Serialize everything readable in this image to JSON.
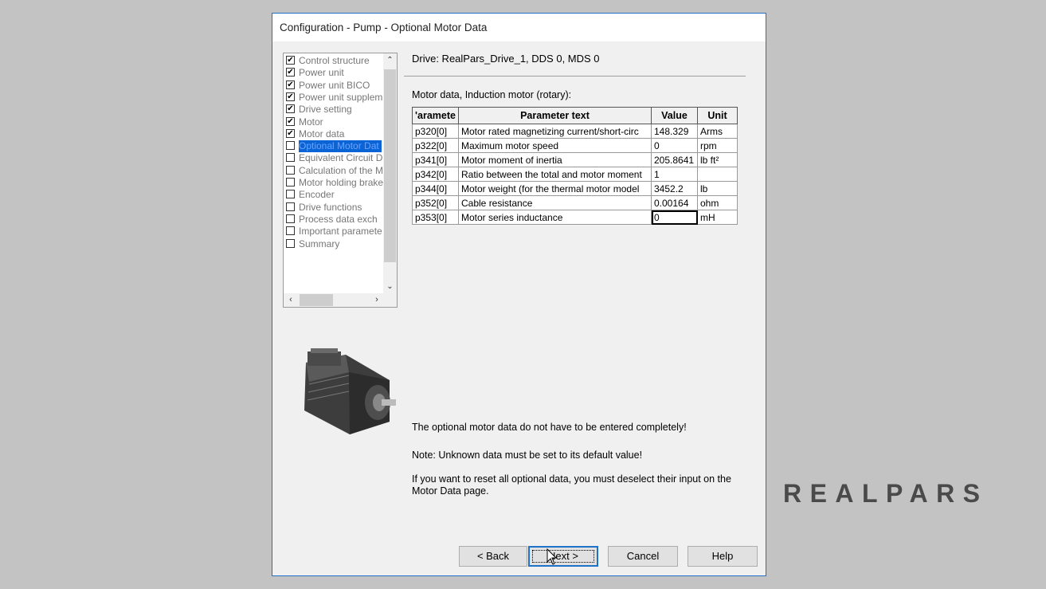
{
  "window": {
    "title": "Configuration - Pump - Optional Motor Data"
  },
  "tree": {
    "items": [
      {
        "label": "Control structure",
        "checked": true
      },
      {
        "label": "Power unit",
        "checked": true
      },
      {
        "label": "Power unit BICO",
        "checked": true
      },
      {
        "label": "Power unit supplem",
        "checked": true
      },
      {
        "label": "Drive setting",
        "checked": true
      },
      {
        "label": "Motor",
        "checked": true
      },
      {
        "label": "Motor data",
        "checked": true
      },
      {
        "label": "Optional Motor Dat",
        "checked": false,
        "selected": true
      },
      {
        "label": "Equivalent Circuit D",
        "checked": false
      },
      {
        "label": "Calculation of the M",
        "checked": false
      },
      {
        "label": "Motor holding brake",
        "checked": false
      },
      {
        "label": "Encoder",
        "checked": false
      },
      {
        "label": "Drive functions",
        "checked": false
      },
      {
        "label": "Process data exch",
        "checked": false
      },
      {
        "label": "Important paramete",
        "checked": false
      },
      {
        "label": "Summary",
        "checked": false
      }
    ]
  },
  "drive_label": "Drive: RealPars_Drive_1, DDS 0, MDS 0",
  "motor_label": "Motor data, Induction motor (rotary):",
  "table": {
    "headers": {
      "param": "'aramete",
      "text": "Parameter text",
      "value": "Value",
      "unit": "Unit"
    },
    "rows": [
      {
        "param": "p320[0]",
        "text": "Motor rated magnetizing current/short-circ",
        "value": "148.329",
        "unit": "Arms"
      },
      {
        "param": "p322[0]",
        "text": "Maximum motor speed",
        "value": "0",
        "unit": "rpm"
      },
      {
        "param": "p341[0]",
        "text": "Motor moment of inertia",
        "value": "205.8641",
        "unit": "lb ft²"
      },
      {
        "param": "p342[0]",
        "text": "Ratio between the total and motor moment",
        "value": "1",
        "unit": ""
      },
      {
        "param": "p344[0]",
        "text": "Motor weight (for the thermal motor model",
        "value": "3452.2",
        "unit": "lb"
      },
      {
        "param": "p352[0]",
        "text": "Cable resistance",
        "value": "0.00164",
        "unit": "ohm"
      },
      {
        "param": "p353[0]",
        "text": "Motor series inductance",
        "value": "0",
        "unit": "mH",
        "editing": true
      }
    ]
  },
  "notes": {
    "optional": "The optional motor data do not have to be entered completely!",
    "unknown": "Note: Unknown data must be set to its default value!",
    "reset": "If you want to reset all optional data, you must deselect their input on the Motor Data page."
  },
  "buttons": {
    "back": "< Back",
    "next": "Next >",
    "cancel": "Cancel",
    "help": "Help"
  },
  "logo": {
    "text": "REALPARS"
  },
  "colors": {
    "accent": "#1e73c8",
    "selection": "#0a64d6",
    "background": "#c3c3c3"
  }
}
